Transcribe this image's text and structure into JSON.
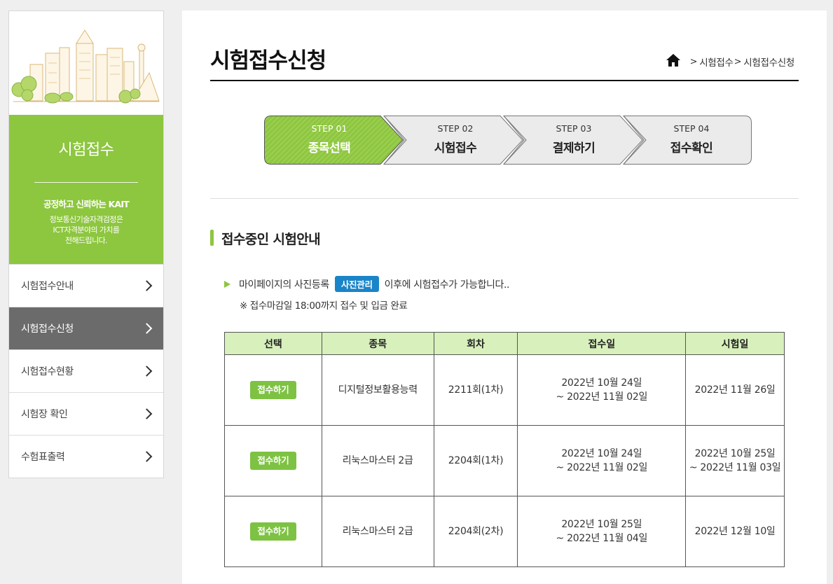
{
  "sidebar": {
    "title": "시험접수",
    "tagline": "공정하고 신뢰하는 KAIT",
    "desc_lines": [
      "정보통신기술자격검정은",
      "ICT자격분야의 가치를",
      "전해드립니다."
    ],
    "menu": [
      {
        "label": "시험접수안내",
        "active": false
      },
      {
        "label": "시험접수신청",
        "active": true
      },
      {
        "label": "시험접수현황",
        "active": false
      },
      {
        "label": "시험장 확인",
        "active": false
      },
      {
        "label": "수험표출력",
        "active": false
      }
    ]
  },
  "header": {
    "title": "시험접수신청",
    "breadcrumb": [
      "시험접수",
      "시험접수신청"
    ]
  },
  "steps": [
    {
      "label": "STEP 01",
      "name": "종목선택",
      "active": true
    },
    {
      "label": "STEP 02",
      "name": "시험접수",
      "active": false
    },
    {
      "label": "STEP 03",
      "name": "결제하기",
      "active": false
    },
    {
      "label": "STEP 04",
      "name": "접수확인",
      "active": false
    }
  ],
  "section": {
    "title": "접수중인 시험안내",
    "notice_before": "마이페이지의 사진등록",
    "photo_button": "사진관리",
    "notice_after": "이후에 시험접수가 가능합니다..",
    "note": "※ 접수마감일 18:00까지 접수 및 입금 완료"
  },
  "table": {
    "headers": [
      "선택",
      "종목",
      "회차",
      "접수일",
      "시험일"
    ],
    "rows": [
      {
        "button": "접수하기",
        "subject": "디지털정보활용능력",
        "round": "2211회(1차)",
        "apply_period": [
          "2022년 10월 24일",
          "~ 2022년 11월 02일"
        ],
        "exam_date": [
          "2022년 11월 26일"
        ]
      },
      {
        "button": "접수하기",
        "subject": "리눅스마스터 2급",
        "round": "2204회(1차)",
        "apply_period": [
          "2022년 10월 24일",
          "~ 2022년 11월 02일"
        ],
        "exam_date": [
          "2022년 10월 25일",
          "~ 2022년 11월 03일"
        ]
      },
      {
        "button": "접수하기",
        "subject": "리눅스마스터 2급",
        "round": "2204회(2차)",
        "apply_period": [
          "2022년 10월 25일",
          "~ 2022년 11월 04일"
        ],
        "exam_date": [
          "2022년 12월 10일"
        ]
      }
    ]
  },
  "colors": {
    "accent_green": "#8dc63f",
    "header_cell": "#d8f0bc",
    "photo_button": "#1a84c8",
    "active_menu": "#6b6b6b"
  }
}
